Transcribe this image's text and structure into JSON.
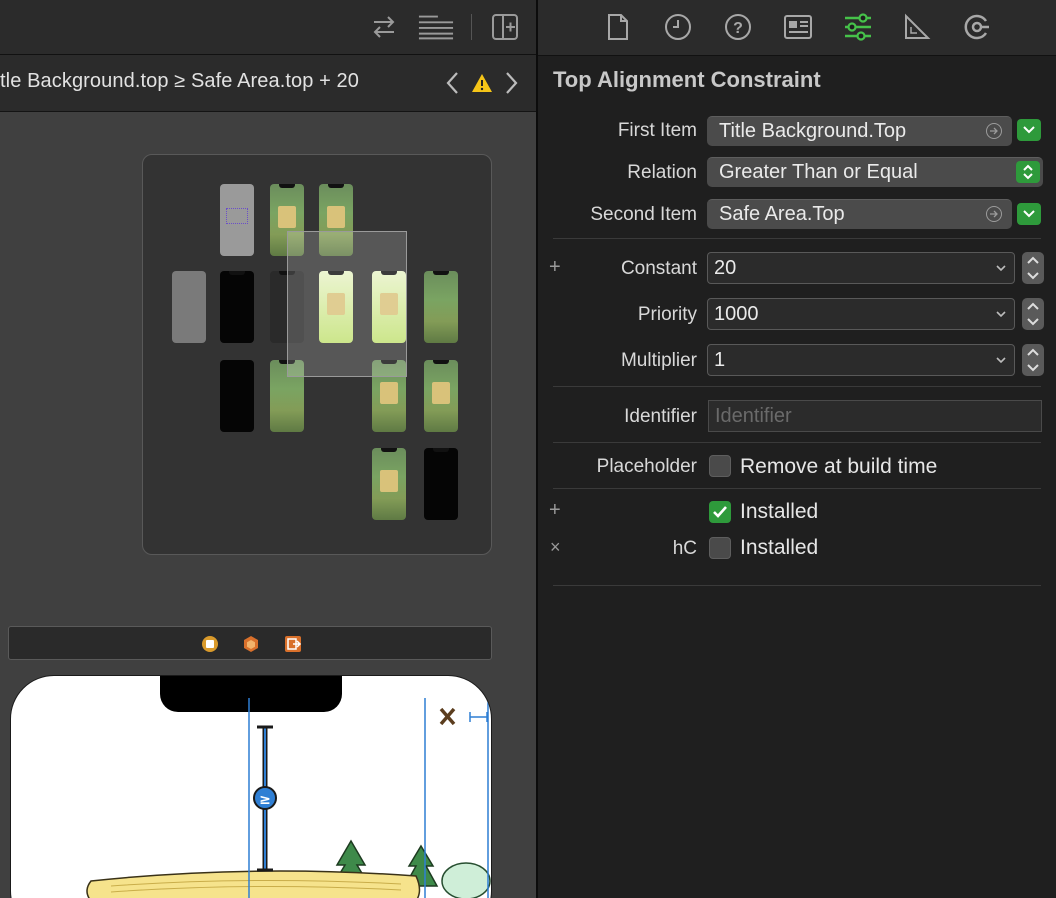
{
  "colors": {
    "accent_green": "#2e9a3b",
    "tab_active": "#46c24a",
    "warning": "#f5c518"
  },
  "editor": {
    "toolbar_icons": [
      "swap-arrows-icon",
      "editor-lines-icon",
      "add-editor-icon"
    ],
    "jump_bar": {
      "text": "tle Background.top ≥ Safe Area.top + 20"
    },
    "scene_bar_icons": [
      "view-controller-icon",
      "first-responder-icon",
      "exit-icon"
    ]
  },
  "inspector": {
    "tabs": [
      "file-icon",
      "history-icon",
      "help-icon",
      "identity-icon",
      "attributes-icon",
      "size-icon",
      "connections-icon"
    ],
    "active_tab": "attributes-icon",
    "title": "Top Alignment Constraint",
    "first_item": {
      "label": "First Item",
      "value": "Title Background.Top"
    },
    "relation": {
      "label": "Relation",
      "value": "Greater Than or Equal"
    },
    "second_item": {
      "label": "Second Item",
      "value": "Safe Area.Top"
    },
    "constant": {
      "label": "Constant",
      "value": "20"
    },
    "priority": {
      "label": "Priority",
      "value": "1000"
    },
    "multiplier": {
      "label": "Multiplier",
      "value": "1"
    },
    "identifier": {
      "label": "Identifier",
      "placeholder": "Identifier"
    },
    "placeholder": {
      "label": "Placeholder",
      "option": "Remove at build time"
    },
    "installed_1": {
      "label": "Installed",
      "checked": true
    },
    "installed_2": {
      "size_class": "hC",
      "label": "Installed",
      "checked": false
    }
  }
}
